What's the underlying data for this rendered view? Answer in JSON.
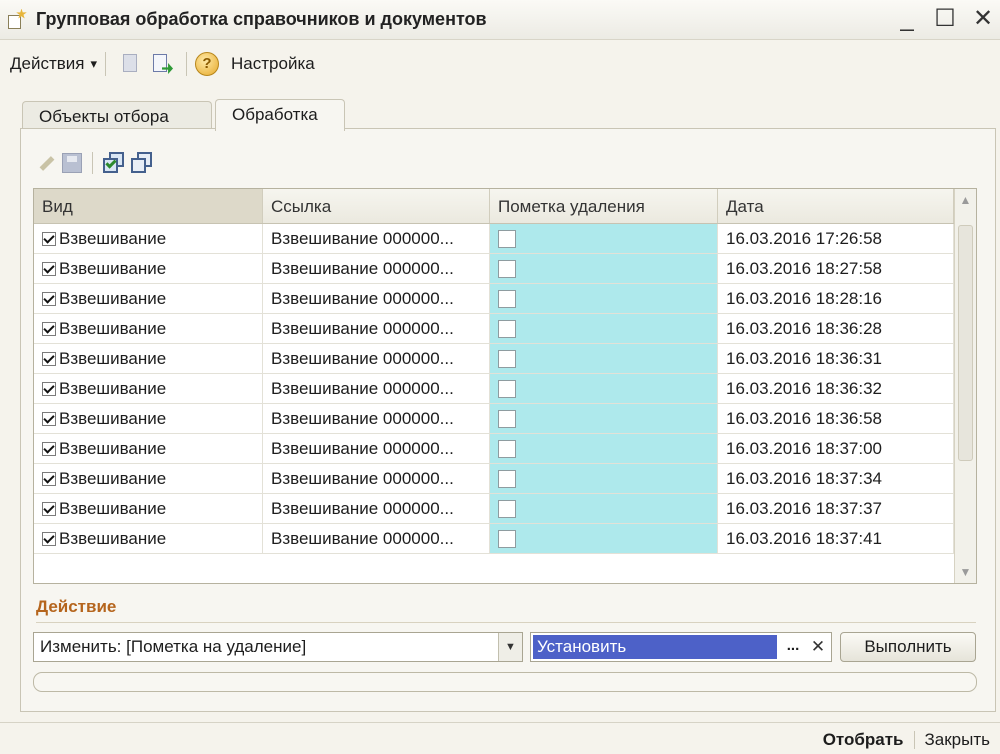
{
  "window": {
    "title": "Групповая обработка справочников и документов",
    "minimize": "_",
    "maximize": "☐",
    "close": "✕"
  },
  "toolbar": {
    "actions_label": "Действия",
    "actions_arrow": "▾",
    "settings_label": "Настройка",
    "help_glyph": "?"
  },
  "tabs": [
    {
      "label": "Объекты отбора"
    },
    {
      "label": "Обработка"
    }
  ],
  "table": {
    "columns": [
      "Вид",
      "Ссылка",
      "Пометка удаления",
      "Дата"
    ],
    "rows": [
      {
        "kind": "Взвешивание",
        "ref": "Взвешивание 000000...",
        "date": "16.03.2016 17:26:58"
      },
      {
        "kind": "Взвешивание",
        "ref": "Взвешивание 000000...",
        "date": "16.03.2016 18:27:58"
      },
      {
        "kind": "Взвешивание",
        "ref": "Взвешивание 000000...",
        "date": "16.03.2016 18:28:16"
      },
      {
        "kind": "Взвешивание",
        "ref": "Взвешивание 000000...",
        "date": "16.03.2016 18:36:28"
      },
      {
        "kind": "Взвешивание",
        "ref": "Взвешивание 000000...",
        "date": "16.03.2016 18:36:31"
      },
      {
        "kind": "Взвешивание",
        "ref": "Взвешивание 000000...",
        "date": "16.03.2016 18:36:32"
      },
      {
        "kind": "Взвешивание",
        "ref": "Взвешивание 000000...",
        "date": "16.03.2016 18:36:58"
      },
      {
        "kind": "Взвешивание",
        "ref": "Взвешивание 000000...",
        "date": "16.03.2016 18:37:00"
      },
      {
        "kind": "Взвешивание",
        "ref": "Взвешивание 000000...",
        "date": "16.03.2016 18:37:34"
      },
      {
        "kind": "Взвешивание",
        "ref": "Взвешивание 000000...",
        "date": "16.03.2016 18:37:37"
      },
      {
        "kind": "Взвешивание",
        "ref": "Взвешивание 000000...",
        "date": "16.03.2016 18:37:41"
      }
    ]
  },
  "action": {
    "label": "Действие",
    "select_value": "Изменить: [Пометка на удаление]",
    "value": "Установить",
    "dots": "...",
    "clear": "✕",
    "execute": "Выполнить"
  },
  "footer": {
    "select": "Отобрать",
    "close": "Закрыть"
  },
  "colors": {
    "mark_cell": "#aee9ec",
    "selection": "#4d61c8",
    "action_label": "#b5651d"
  }
}
